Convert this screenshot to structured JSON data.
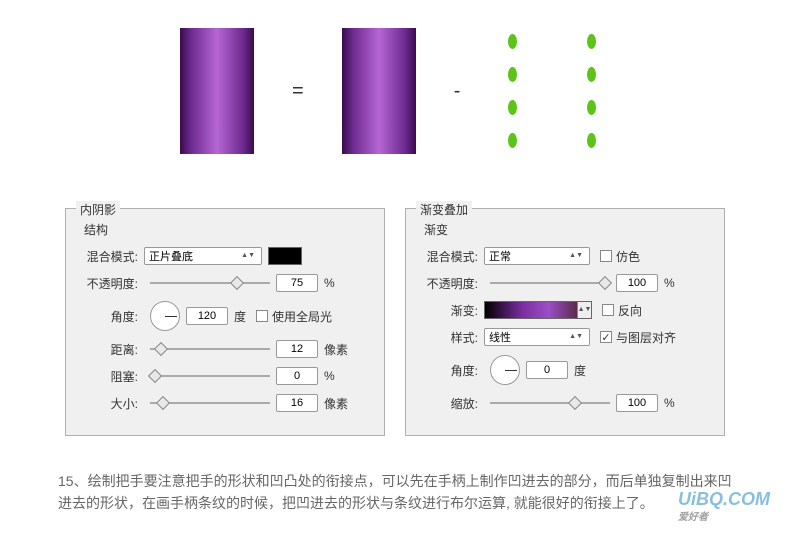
{
  "illustration": {
    "equals": "=",
    "minus": "-"
  },
  "panel_inner_shadow": {
    "title": "内阴影",
    "structure": "结构",
    "blend_mode_label": "混合模式:",
    "blend_mode_value": "正片叠底",
    "opacity_label": "不透明度:",
    "opacity_value": "75",
    "opacity_unit": "%",
    "angle_label": "角度:",
    "angle_value": "120",
    "angle_unit": "度",
    "global_light_label": "使用全局光",
    "distance_label": "距离:",
    "distance_value": "12",
    "distance_unit": "像素",
    "choke_label": "阻塞:",
    "choke_value": "0",
    "choke_unit": "%",
    "size_label": "大小:",
    "size_value": "16",
    "size_unit": "像素"
  },
  "panel_gradient": {
    "title": "渐变叠加",
    "gradient_section": "渐变",
    "blend_mode_label": "混合模式:",
    "blend_mode_value": "正常",
    "dither_label": "仿色",
    "opacity_label": "不透明度:",
    "opacity_value": "100",
    "opacity_unit": "%",
    "gradient_label": "渐变:",
    "reverse_label": "反向",
    "style_label": "样式:",
    "style_value": "线性",
    "align_label": "与图层对齐",
    "angle_label": "角度:",
    "angle_value": "0",
    "angle_unit": "度",
    "scale_label": "缩放:",
    "scale_value": "100",
    "scale_unit": "%"
  },
  "caption": "15、绘制把手要注意把手的形状和凹凸处的衔接点，可以先在手柄上制作凹进去的部分，而后单独复制出来凹进去的形状，在画手柄条纹的时候，把凹进去的形状与条纹进行布尔运算, 就能很好的衔接上了。",
  "watermark": {
    "main": "UiBQ.COM",
    "sub": "爱好者"
  }
}
